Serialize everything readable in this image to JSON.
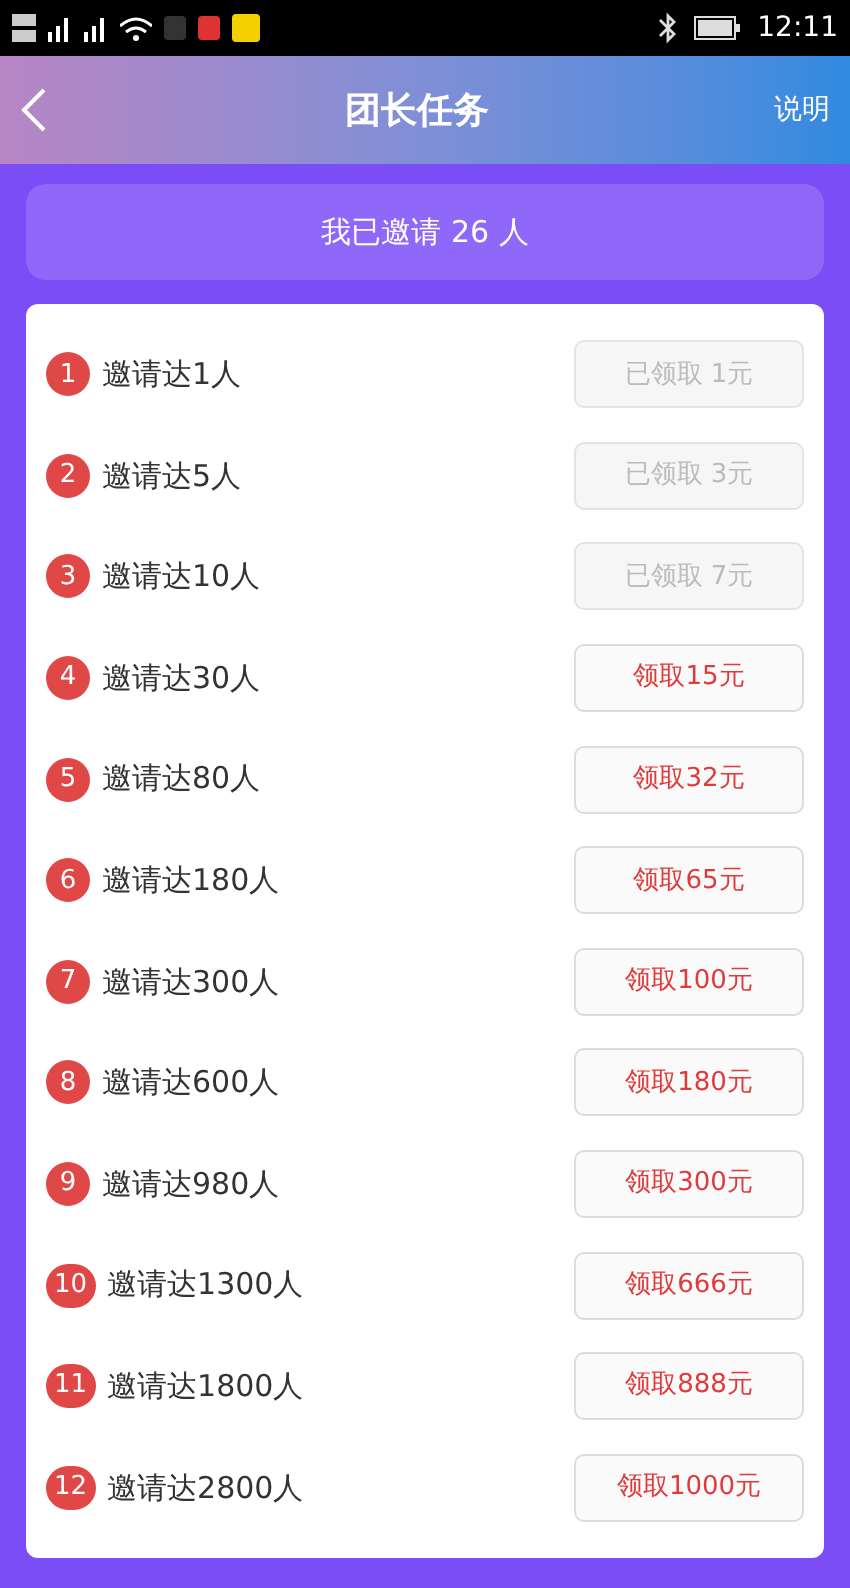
{
  "status_bar": {
    "time": "12:11"
  },
  "header": {
    "title": "团长任务",
    "action": "说明"
  },
  "banner": {
    "text": "我已邀请 26 人"
  },
  "tasks": [
    {
      "number": "1",
      "label": "邀请达1人",
      "button": "已领取 1元",
      "claimed": true
    },
    {
      "number": "2",
      "label": "邀请达5人",
      "button": "已领取 3元",
      "claimed": true
    },
    {
      "number": "3",
      "label": "邀请达10人",
      "button": "已领取 7元",
      "claimed": true
    },
    {
      "number": "4",
      "label": "邀请达30人",
      "button": "领取15元",
      "claimed": false
    },
    {
      "number": "5",
      "label": "邀请达80人",
      "button": "领取32元",
      "claimed": false
    },
    {
      "number": "6",
      "label": "邀请达180人",
      "button": "领取65元",
      "claimed": false
    },
    {
      "number": "7",
      "label": "邀请达300人",
      "button": "领取100元",
      "claimed": false
    },
    {
      "number": "8",
      "label": "邀请达600人",
      "button": "领取180元",
      "claimed": false
    },
    {
      "number": "9",
      "label": "邀请达980人",
      "button": "领取300元",
      "claimed": false
    },
    {
      "number": "10",
      "label": "邀请达1300人",
      "button": "领取666元",
      "claimed": false
    },
    {
      "number": "11",
      "label": "邀请达1800人",
      "button": "领取888元",
      "claimed": false
    },
    {
      "number": "12",
      "label": "邀请达2800人",
      "button": "领取1000元",
      "claimed": false
    }
  ]
}
